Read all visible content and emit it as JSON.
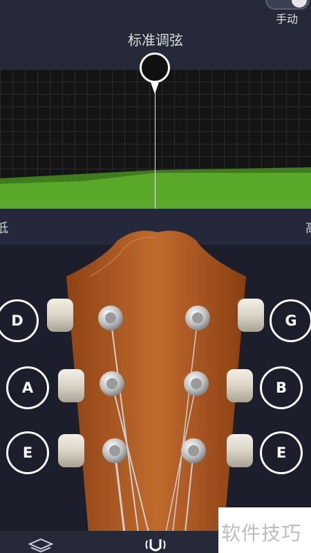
{
  "header": {
    "title": "标准调弦",
    "mode_label": "手动"
  },
  "scale": {
    "low_label": "低",
    "high_label": "高"
  },
  "strings": {
    "left": [
      "D",
      "A",
      "E"
    ],
    "right": [
      "G",
      "B",
      "E"
    ]
  },
  "watermark": "软件技巧",
  "colors": {
    "background": "#1c1f2b",
    "wave_green": "#4f9b24",
    "wood": "#b8602a"
  },
  "icons": {
    "nav_left": "layers-icon",
    "nav_center": "tuner-fork-icon"
  }
}
